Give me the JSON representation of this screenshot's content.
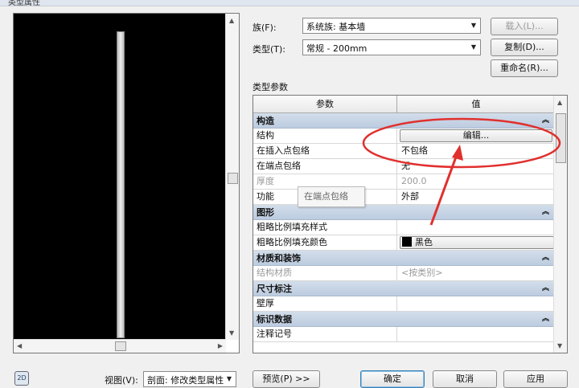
{
  "window": {
    "title": "类型属性"
  },
  "fields": {
    "family_label": "族(F):",
    "family_value": "系统族: 基本墙",
    "type_label": "类型(T):",
    "type_value": "常规 - 200mm"
  },
  "buttons": {
    "load": "载入(L)...",
    "duplicate": "复制(D)...",
    "rename": "重命名(R)...",
    "preview": "预览(P) >>",
    "ok": "确定",
    "cancel": "取消",
    "apply": "应用"
  },
  "section": {
    "type_params": "类型参数"
  },
  "table": {
    "col_param": "参数",
    "col_value": "值",
    "groups": {
      "construction": "构造",
      "graphics": "图形",
      "materials": "材质和装饰",
      "dimensions": "尺寸标注",
      "identity": "标识数据"
    },
    "rows": {
      "structure": {
        "name": "结构",
        "value": "编辑..."
      },
      "wrap_insert": {
        "name": "在插入点包络",
        "value": "不包络"
      },
      "wrap_end": {
        "name": "在端点包络",
        "value": "无"
      },
      "thickness": {
        "name": "厚度",
        "value": "200.0"
      },
      "function": {
        "name": "功能",
        "value": "外部"
      },
      "coarse_pattern": {
        "name": "粗略比例填充样式",
        "value": ""
      },
      "coarse_color": {
        "name": "粗略比例填充颜色",
        "value": "黑色"
      },
      "struct_material": {
        "name": "结构材质",
        "value": "<按类别>"
      },
      "wall_thickness": {
        "name": "壁厚",
        "value": ""
      },
      "keynote": {
        "name": "注释记号",
        "value": ""
      }
    }
  },
  "tooltip": {
    "text": "在端点包络"
  },
  "bottom": {
    "view_label": "视图(V):",
    "view_value": "剖面: 修改类型属性",
    "icon_2d": "2D"
  },
  "colors": {
    "annotation": "#e0302e",
    "group_header": "#c7d5e5"
  }
}
